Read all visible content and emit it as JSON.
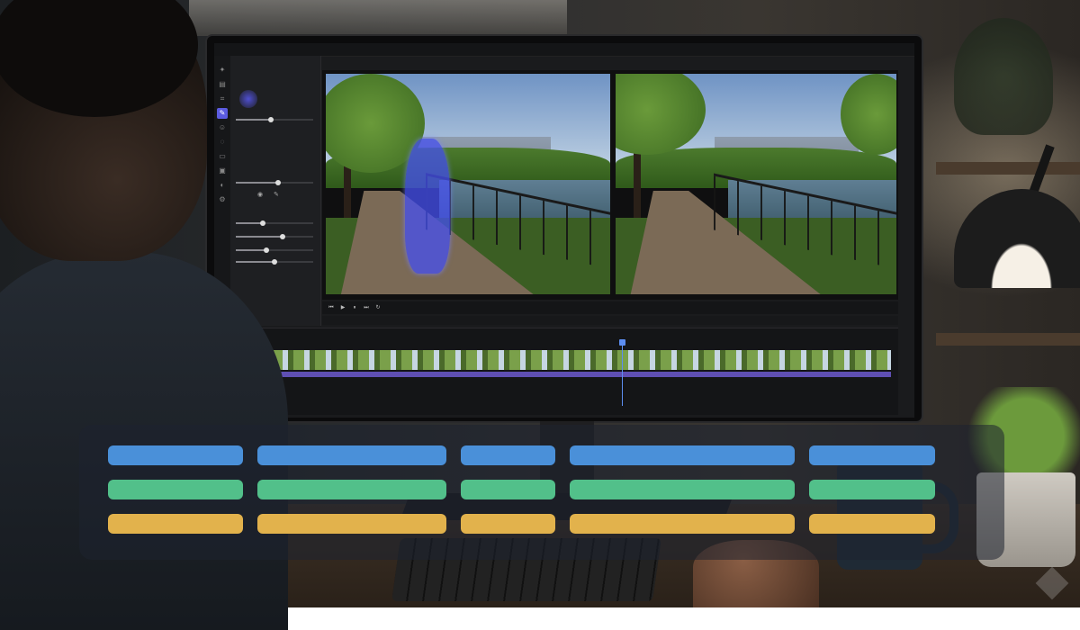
{
  "editor": {
    "topbar": {
      "left_text": "",
      "center_text": ""
    },
    "tools": [
      {
        "icon": "magic-wand-icon",
        "active": false
      },
      {
        "icon": "layers-icon",
        "active": false
      },
      {
        "icon": "crop-icon",
        "active": false
      },
      {
        "icon": "brush-icon",
        "active": true
      },
      {
        "icon": "person-select-icon",
        "active": false
      },
      {
        "icon": "lasso-icon",
        "active": false
      },
      {
        "icon": "eraser-icon",
        "active": false
      },
      {
        "icon": "stamp-icon",
        "active": false
      },
      {
        "icon": "adjust-icon",
        "active": false
      },
      {
        "icon": "settings-icon",
        "active": false
      }
    ],
    "panel": {
      "sliders": [
        {
          "value": 0.45
        },
        {
          "value": 0.55
        },
        {
          "value": 0.35
        },
        {
          "value": 0.6
        },
        {
          "value": 0.4
        },
        {
          "value": 0.5
        }
      ]
    },
    "transport": {
      "icons": [
        "skip-back-icon",
        "play-icon",
        "pause-icon",
        "skip-forward-icon",
        "loop-icon"
      ]
    },
    "timeline": {
      "label": "",
      "playhead_position": 0.58,
      "side_icons": [
        "eye-icon",
        "lock-icon",
        "mute-icon",
        "settings-icon",
        "add-icon"
      ]
    }
  },
  "overlay": {
    "colors": {
      "row1": "#4a90d9",
      "row2": "#52c08a",
      "row3": "#e2b24c"
    },
    "columns": 5
  }
}
